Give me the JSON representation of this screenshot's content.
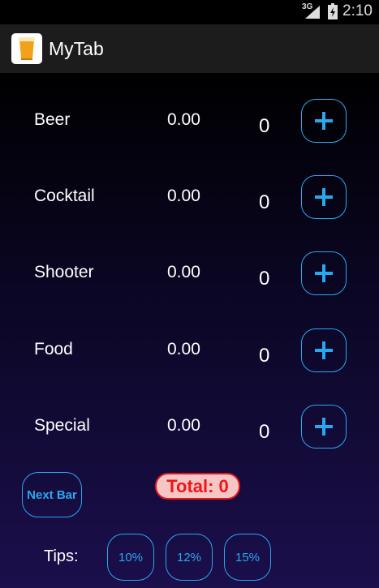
{
  "status_bar": {
    "network": "3G",
    "time": "2:10"
  },
  "app": {
    "title": "MyTab"
  },
  "items": [
    {
      "name": "Beer",
      "price": "0.00",
      "quantity": "0",
      "add_label": "+"
    },
    {
      "name": "Cocktail",
      "price": "0.00",
      "quantity": "0",
      "add_label": "+"
    },
    {
      "name": "Shooter",
      "price": "0.00",
      "quantity": "0",
      "add_label": "+"
    },
    {
      "name": "Food",
      "price": "0.00",
      "quantity": "0",
      "add_label": "+"
    },
    {
      "name": "Special",
      "price": "0.00",
      "quantity": "0",
      "add_label": "+"
    }
  ],
  "next_bar": {
    "label": "Next Bar"
  },
  "total": {
    "label": "Total: 0"
  },
  "tips": {
    "label": "Tips:",
    "options": [
      "10%",
      "12%",
      "15%"
    ]
  },
  "colors": {
    "accent": "#29a8ee",
    "total_text": "#ee1515",
    "total_bg": "#f6c6c6",
    "action_bar": "#1c1c1c"
  }
}
